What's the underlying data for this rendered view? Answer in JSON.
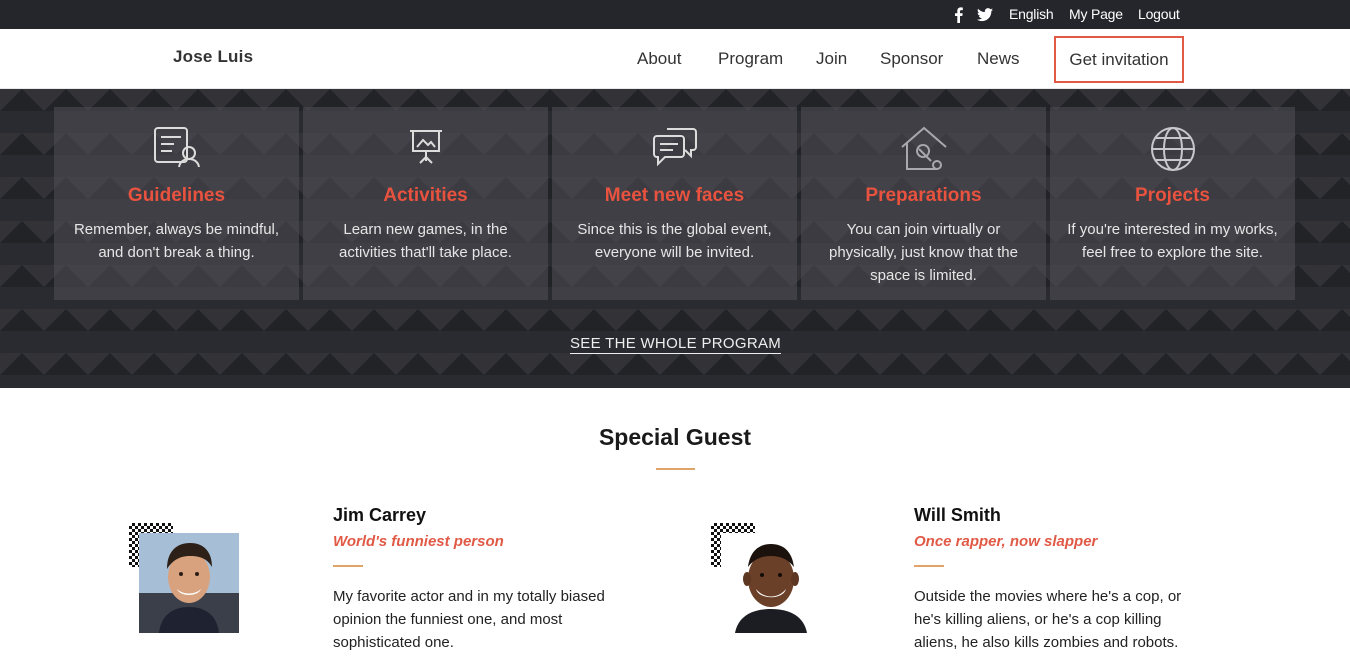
{
  "topbar": {
    "icons": [
      "facebook-icon",
      "twitter-icon"
    ],
    "links": [
      "English",
      "My Page",
      "Logout"
    ]
  },
  "nav": {
    "brand": "Jose Luis",
    "links": [
      "About",
      "Program",
      "Join",
      "Sponsor",
      "News"
    ],
    "cta": "Get invitation"
  },
  "features": [
    {
      "icon": "guidelines-icon",
      "title": "Guidelines",
      "text": "Remember, always be mindful, and don't break a thing."
    },
    {
      "icon": "presentation-icon",
      "title": "Activities",
      "text": "Learn new games, in the activities that'll take place."
    },
    {
      "icon": "chat-bubbles-icon",
      "title": "Meet new faces",
      "text": "Since this is the global event, everyone will be invited."
    },
    {
      "icon": "home-tools-icon",
      "title": "Preparations",
      "text": "You can join virtually or physically, just know that the space is limited."
    },
    {
      "icon": "globe-icon",
      "title": "Projects",
      "text": "If you're interested in my works, feel free to explore the site."
    }
  ],
  "see_program": "SEE THE WHOLE PROGRAM",
  "special_guest": {
    "title": "Special Guest",
    "guests": [
      {
        "name": "Jim Carrey",
        "role": "World's funniest person",
        "bio": "My favorite actor and in my totally biased opinion the funniest one, and most sophisticated one."
      },
      {
        "name": "Will Smith",
        "role": "Once rapper, now slapper",
        "bio": "Outside the movies where he's a cop, or he's killing aliens, or he's a cop killing aliens, he also kills zombies and robots."
      }
    ]
  },
  "colors": {
    "accent": "#e8523f",
    "dark_band": "#2a2b30",
    "topbar": "#25262b",
    "rule": "#e0a36a"
  }
}
